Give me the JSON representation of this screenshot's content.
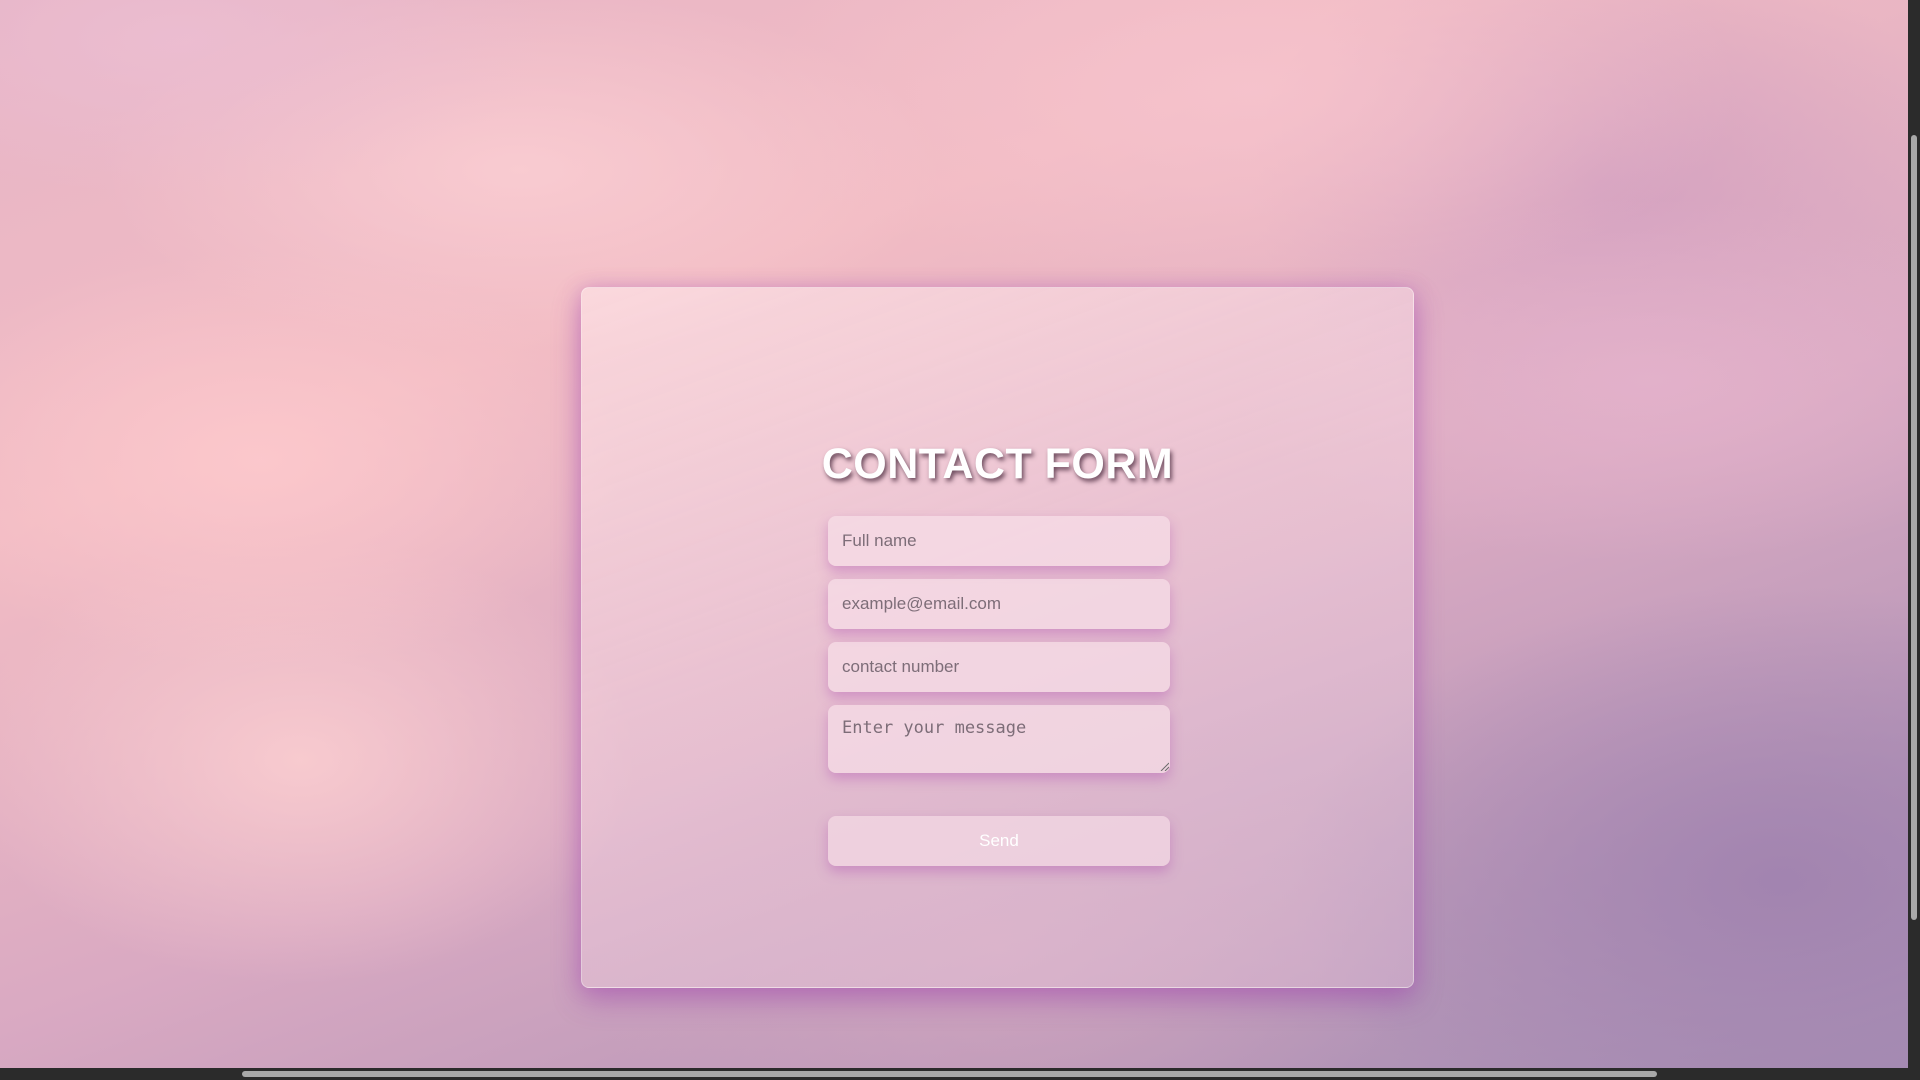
{
  "form": {
    "title": "CONTACT FORM",
    "fields": {
      "full_name": {
        "placeholder": "Full name",
        "value": ""
      },
      "email": {
        "placeholder": "example@email.com",
        "value": ""
      },
      "contact_number": {
        "placeholder": "contact number",
        "value": ""
      },
      "message": {
        "placeholder": "Enter your message",
        "value": ""
      }
    },
    "send_label": "Send"
  },
  "colors": {
    "title_text": "#ffffff",
    "card_glow": "#9c3caa",
    "field_background": "#f6dee8"
  }
}
